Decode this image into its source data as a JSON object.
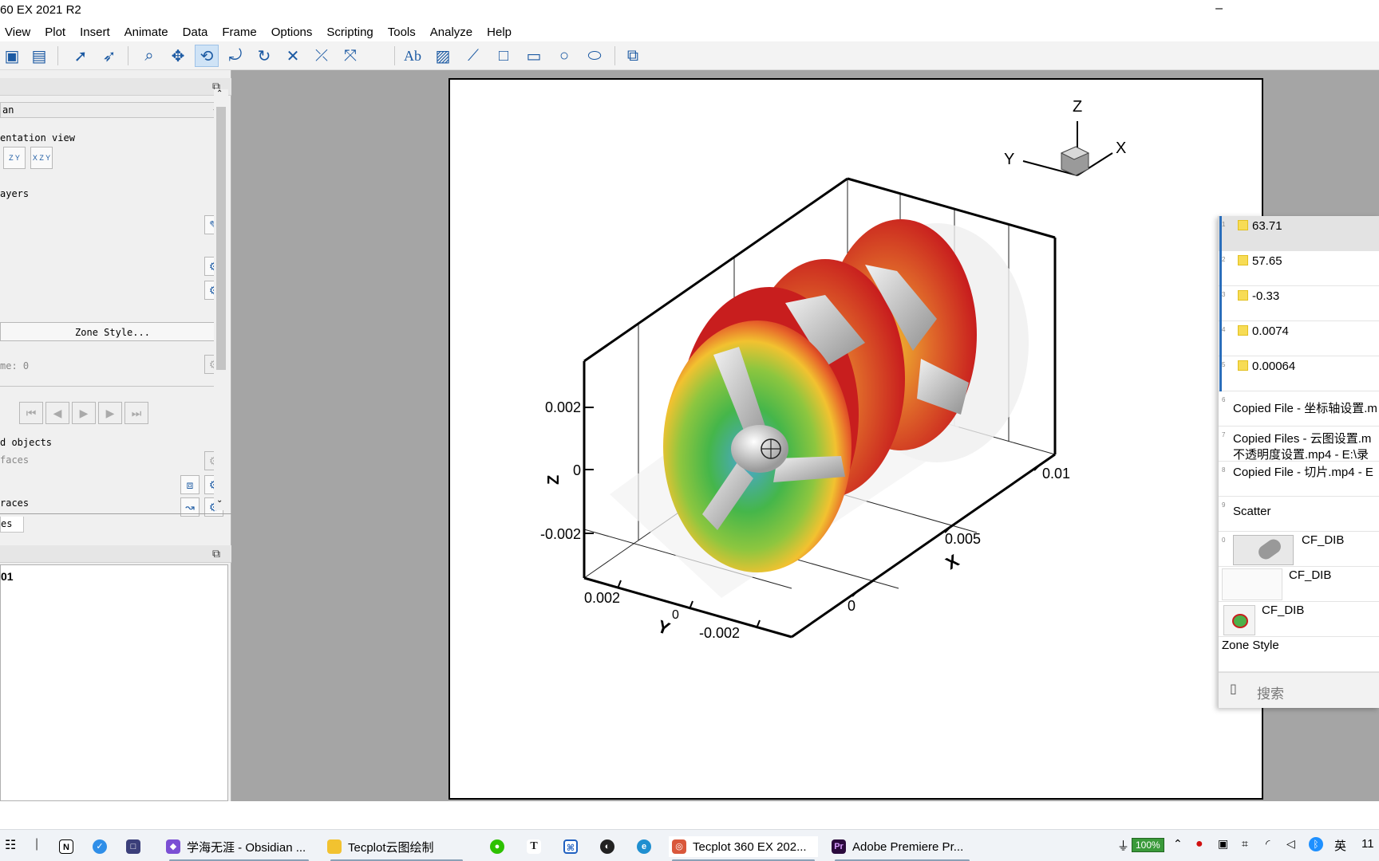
{
  "window": {
    "title": "60 EX 2021 R2",
    "minimize": "–"
  },
  "menu": [
    "View",
    "Plot",
    "Insert",
    "Animate",
    "Data",
    "Frame",
    "Options",
    "Scripting",
    "Tools",
    "Analyze",
    "Help"
  ],
  "toolbar": {
    "items": [
      "save-icon",
      "export-icon",
      "select-icon",
      "adjust-icon",
      "zoom-icon",
      "translate-icon",
      "rotate-xy-icon",
      "rotate-spherical-icon",
      "rollerball-icon",
      "rotate-x-icon",
      "rotate-y-icon",
      "rotate-z-icon",
      "text-icon",
      "image-icon",
      "polyline-icon",
      "square-icon",
      "rectangle-icon",
      "circle-icon",
      "ellipse-icon",
      "frame-icon"
    ]
  },
  "left_panel": {
    "plot_type_value": "an",
    "orientation_label": "entation view",
    "orient_btn_1": "Z Y",
    "orient_btn_2": "X Z Y",
    "layers_label": "ayers",
    "zone_style_button": "Zone Style...",
    "time_label": "me: 0",
    "derived_label": "d objects",
    "faces_label": "faces",
    "traces_label": "races",
    "tab_label": "es",
    "lower_value": "01"
  },
  "plot": {
    "z_ticks": [
      "0.002",
      "0",
      "-0.002"
    ],
    "x_ticks": [
      "0.01",
      "0.005",
      "0"
    ],
    "y_ticks": [
      "0.002",
      "0",
      "-0.002"
    ],
    "z_label": "Z",
    "x_label": "X",
    "y_label": "Y",
    "triad": {
      "z": "Z",
      "x": "X",
      "y": "Y"
    }
  },
  "clipboard": {
    "items": [
      {
        "num": "1",
        "text": "63.71"
      },
      {
        "num": "2",
        "text": "57.65"
      },
      {
        "num": "3",
        "text": "-0.33"
      },
      {
        "num": "4",
        "text": "0.0074"
      },
      {
        "num": "5",
        "text": "0.00064"
      },
      {
        "num": "6",
        "text": "Copied File - 坐标轴设置.m"
      },
      {
        "num": "7",
        "text": "Copied Files - 云图设置.m",
        "text2": "不透明度设置.mp4 - E:\\录"
      },
      {
        "num": "8",
        "text": "Copied File - 切片.mp4 - E"
      },
      {
        "num": "9",
        "text": "Scatter"
      },
      {
        "num": "0",
        "text": "CF_DIB"
      },
      {
        "num": "",
        "text": "CF_DIB"
      },
      {
        "num": "",
        "text": "CF_DIB"
      },
      {
        "num": "",
        "text": "Zone Style"
      }
    ],
    "search_placeholder": "搜索"
  },
  "taskbar": {
    "obsidian": "学海无涯 - Obsidian ...",
    "folder": "Tecplot云图绘制",
    "tecplot": "Tecplot 360 EX 202...",
    "premiere": "Adobe Premiere Pr...",
    "battery": "100%",
    "ime": "英",
    "clock": "11"
  },
  "colors": {
    "workspace": "#a5a5a5",
    "accent": "#2a6ebb",
    "contour_red": "#c81e1e",
    "contour_green": "#3bb54a"
  }
}
